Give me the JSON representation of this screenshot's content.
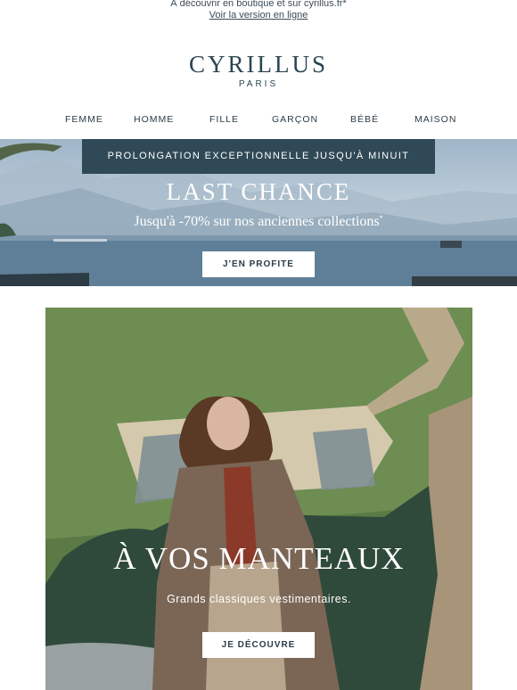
{
  "preheader": {
    "text": "À découvrir en boutique et sur cyrillus.fr*",
    "view_online": "Voir la version en ligne"
  },
  "logo": {
    "brand": "CYRILLUS",
    "city": "PARIS"
  },
  "nav": {
    "items": [
      "FEMME",
      "HOMME",
      "FILLE",
      "GARÇON",
      "BÉBÉ",
      "MAISON"
    ]
  },
  "hero": {
    "banner": "PROLONGATION EXCEPTIONNELLE JUSQU'À MINUIT",
    "title": "LAST CHANCE",
    "subtitle": "Jusqu'à -70% sur nos anciennes collections",
    "subtitle_mark": "*",
    "cta": "J'EN PROFITE"
  },
  "feature": {
    "title": "À VOS MANTEAUX",
    "subtitle": "Grands classiques vestimentaires.",
    "cta": "JE DÉCOUVRE"
  },
  "colors": {
    "brand": "#2c4452",
    "banner_bg": "#2f4a56",
    "button_bg": "#ffffff"
  }
}
